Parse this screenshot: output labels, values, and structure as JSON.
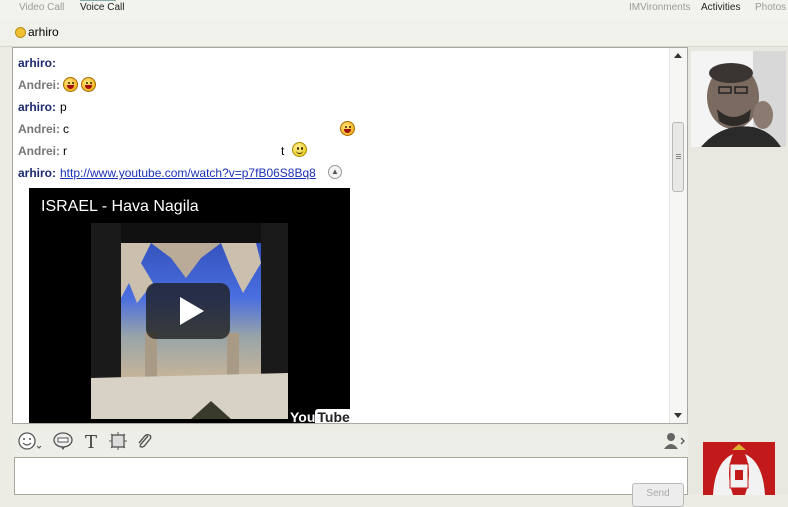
{
  "toolbar": {
    "video_call": "Video Call",
    "voice_call": "Voice Call",
    "imvironments": "IMVironments",
    "activities": "Activities",
    "photos": "Photos"
  },
  "contact": {
    "name": "arhiro",
    "status_color": "#f0c030"
  },
  "messages": [
    {
      "sender": "arhiro:",
      "text": ""
    },
    {
      "sender": "Andrei:",
      "text": ""
    },
    {
      "sender": "arhiro:",
      "text": "p"
    },
    {
      "sender": "Andrei:",
      "text": "c"
    },
    {
      "sender": "Andrei:",
      "text": "r",
      "tail": "t"
    },
    {
      "sender": "arhiro:",
      "link": "http://www.youtube.com/watch?v=p7fB06S8Bq8"
    }
  ],
  "video": {
    "title": "ISRAEL - Hava Nagila",
    "logo_you": "You",
    "logo_tube": "Tube"
  },
  "input": {
    "send_label": "Send"
  },
  "colors": {
    "my_name": "#1c2a6e",
    "other_name": "#777777",
    "link": "#1a31b6"
  }
}
